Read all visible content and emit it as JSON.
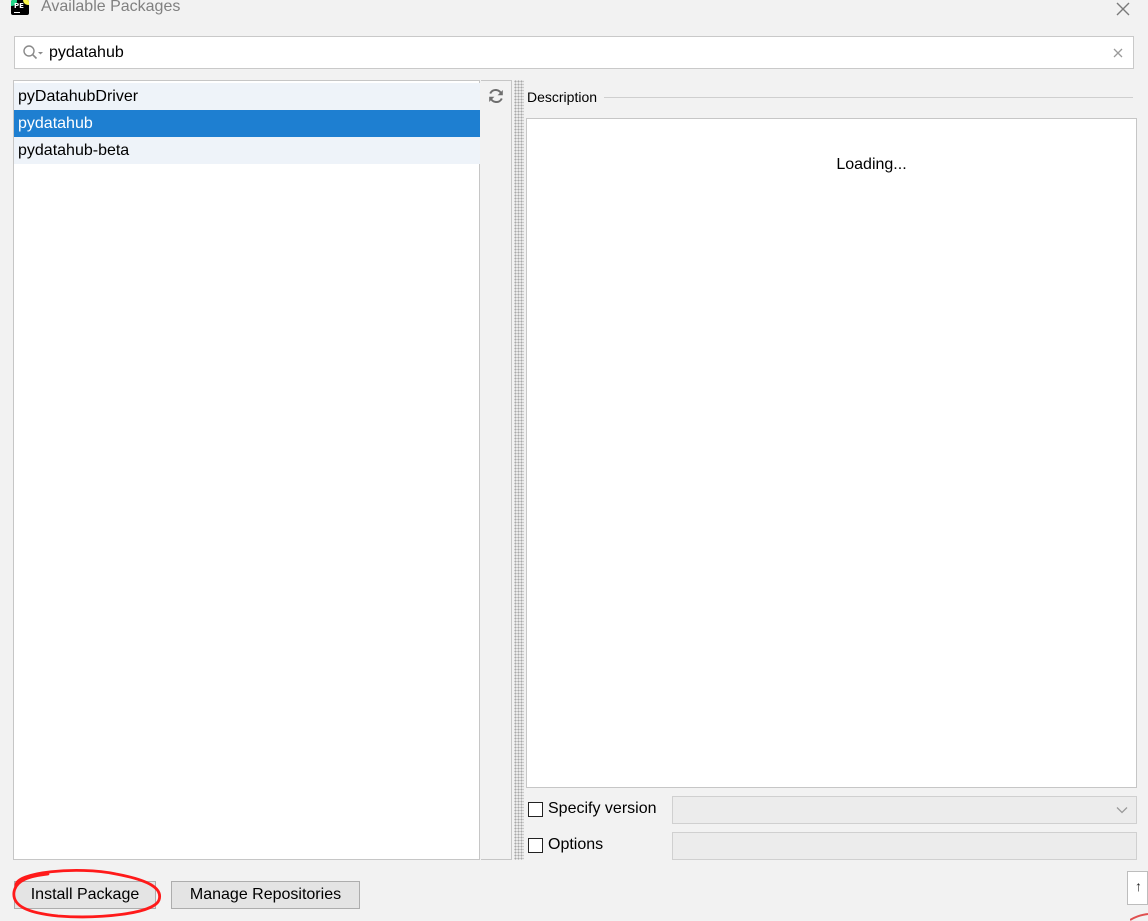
{
  "window": {
    "title": "Available Packages",
    "app_icon_text": "PE",
    "app_icon": "pycharm-icon",
    "close_icon": "close-icon"
  },
  "search": {
    "value": "pydatahub",
    "icon": "search-icon",
    "clear_icon": "clear-icon"
  },
  "packages": {
    "items": [
      {
        "label": "pyDatahubDriver",
        "selected": false
      },
      {
        "label": "pydatahub",
        "selected": true
      },
      {
        "label": "pydatahub-beta",
        "selected": false
      }
    ],
    "refresh_icon": "refresh-icon"
  },
  "description": {
    "label": "Description",
    "status": "Loading..."
  },
  "options": {
    "specify_version_label": "Specify version",
    "specify_version_checked": false,
    "version_value": "",
    "options_label": "Options",
    "options_checked": false,
    "options_value": ""
  },
  "buttons": {
    "install": "Install Package",
    "manage": "Manage Repositories"
  },
  "colors": {
    "selection": "#1e7fd1",
    "list_row": "#eef3f9",
    "annotation": "#ff0000"
  }
}
